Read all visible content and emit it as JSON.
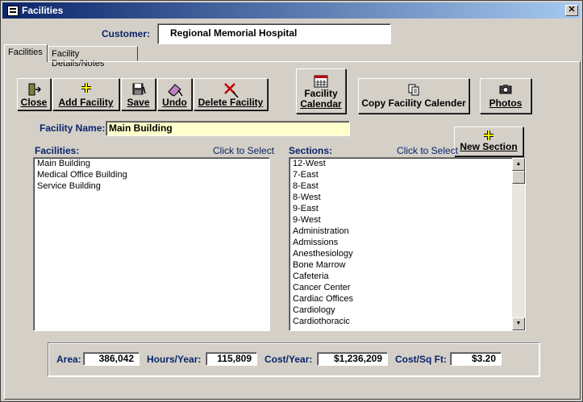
{
  "window": {
    "title": "Facilities",
    "close_glyph": "✕"
  },
  "customer": {
    "label": "Customer:",
    "value": "Regional Memorial Hospital"
  },
  "tabs": [
    {
      "label": "Facilities",
      "active": true
    },
    {
      "label": "Facility Details/Notes",
      "active": false
    }
  ],
  "toolbar": {
    "close": {
      "label": "Close",
      "icon": "exit-door-icon"
    },
    "add": {
      "label": "Add Facility",
      "icon": "plus-icon"
    },
    "save": {
      "label": "Save",
      "icon": "floppy-disk-icon"
    },
    "undo": {
      "label": "Undo",
      "icon": "eraser-icon"
    },
    "delete": {
      "label": "Delete Facility",
      "icon": "delete-x-icon"
    },
    "calendar": {
      "label_line1": "Facility",
      "label_line2": "Calendar",
      "icon": "calendar-icon"
    },
    "copy_calendar": {
      "label": "Copy Facility Calender",
      "icon": "copy-pages-icon"
    },
    "photos": {
      "label": "Photos",
      "icon": "camera-icon"
    },
    "new_section": {
      "label": "New Section",
      "icon": "plus-icon"
    }
  },
  "facility_name": {
    "label": "Facility Name:",
    "value": "Main Building"
  },
  "facilities_list": {
    "label": "Facilities:",
    "hint": "Click to Select",
    "items": [
      "Main Building",
      "Medical Office Building",
      "Service Building"
    ]
  },
  "sections_list": {
    "label": "Sections:",
    "hint": "Click to Select",
    "items": [
      "12-West",
      "7-East",
      "8-East",
      "8-West",
      "9-East",
      "9-West",
      "Administration",
      "Admissions",
      "Anesthesiology",
      "Bone Marrow",
      "Cafeteria",
      "Cancer Center",
      "Cardiac Offices",
      "Cardiology",
      "Cardiothoracic"
    ]
  },
  "stats": {
    "area": {
      "label": "Area:",
      "value": "386,042"
    },
    "hours": {
      "label": "Hours/Year:",
      "value": "115,809"
    },
    "cost_year": {
      "label": "Cost/Year:",
      "value": "$1,236,209"
    },
    "cost_sqft": {
      "label": "Cost/Sq Ft:",
      "value": "$3.20"
    }
  },
  "colors": {
    "titlebar_start": "#0a246a",
    "label_blue": "#0a246a",
    "highlight_field": "#ffffcc"
  }
}
